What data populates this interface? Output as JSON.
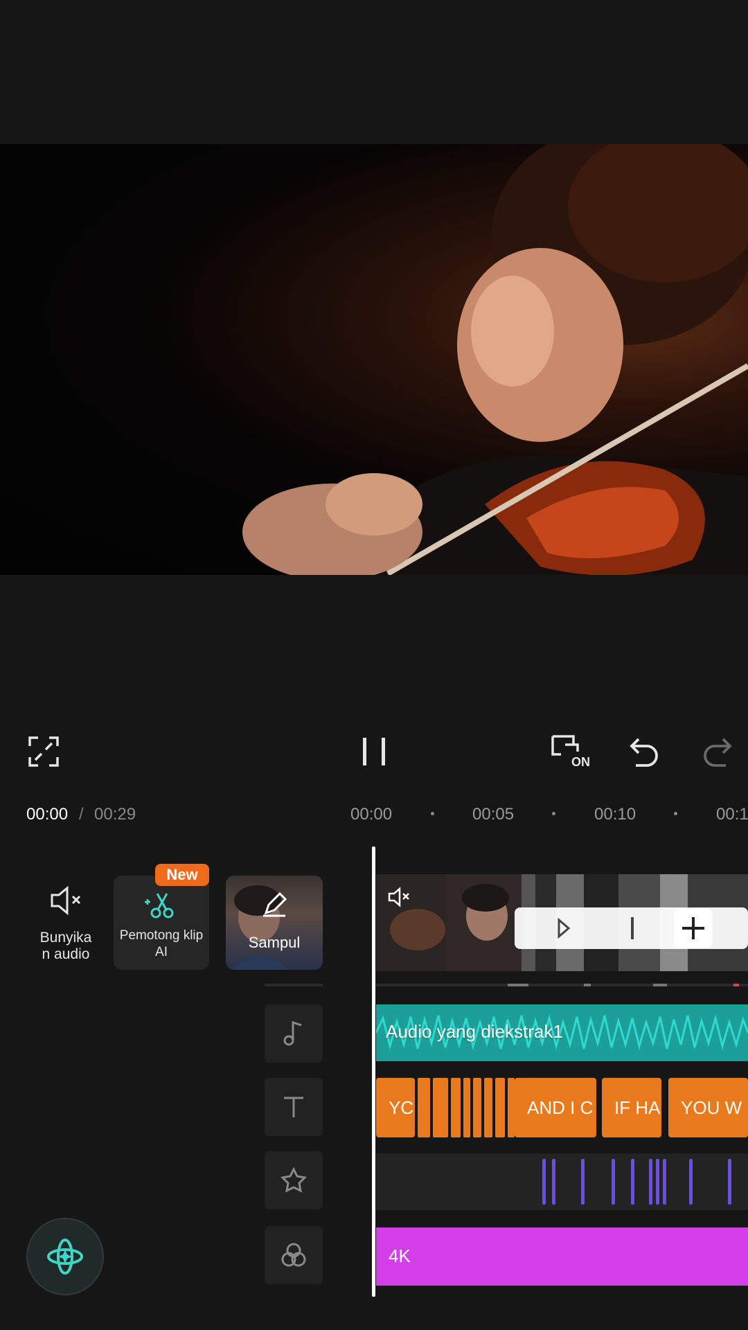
{
  "controls": {
    "fullscreen_icon": "fullscreen-icon",
    "pause_icon": "pause-icon",
    "keyframe_on_label": "ON",
    "undo_icon": "undo-icon",
    "redo_icon": "redo-icon"
  },
  "time": {
    "current": "00:00",
    "separator": "/",
    "total": "00:29",
    "ruler": [
      "00:00",
      "00:05",
      "00:10",
      "00:1"
    ]
  },
  "tools": {
    "mute": {
      "label": "Bunyika\nn audio",
      "line1": "Bunyika",
      "line2": "n audio"
    },
    "ai_cutter": {
      "badge": "New",
      "line1": "Pemotong klip",
      "line2": "AI"
    },
    "cover": {
      "label": "Sampul"
    }
  },
  "track_buttons": [
    "music-note-icon",
    "text-icon",
    "effects-star-icon",
    "filters-icon"
  ],
  "timeline": {
    "audio_label": "Audio yang diekstrak1",
    "text_clips": [
      "YC",
      "AND I C",
      "IF HA",
      "YOU W"
    ],
    "filter_label": "4K"
  },
  "colors": {
    "audio": "#1b9f98",
    "text_clip": "#e8791d",
    "effect": "#6a4cf0",
    "filter": "#d43ee8",
    "new_badge": "#f06a1a",
    "accent_teal": "#3fd6c8"
  }
}
